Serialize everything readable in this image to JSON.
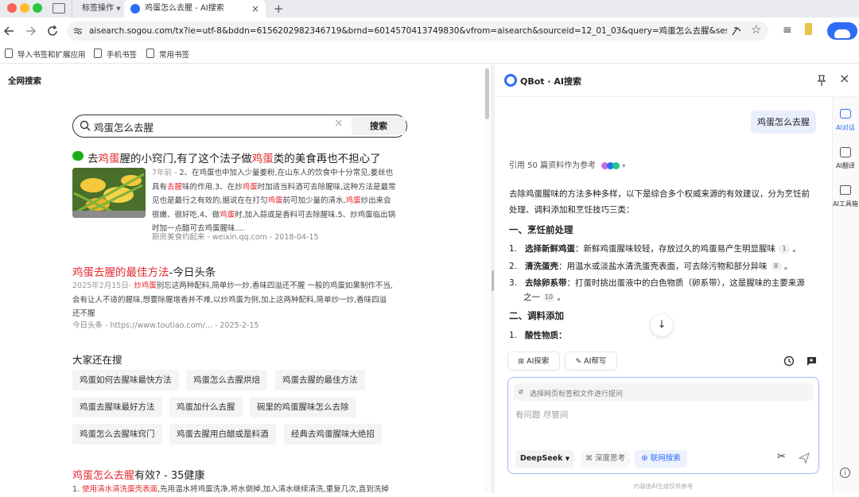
{
  "browser": {
    "tabs": [
      {
        "label": "标签操作"
      },
      {
        "label": "鸡蛋怎么去腥 - AI搜索"
      }
    ],
    "url": "aisearch.sogou.com/tx?ie=utf-8&bddn=6156202982346719&brnd=6014570413749830&vfrom=aisearch&sourceid=12_01_03&query=鸡蛋怎么去腥&session...",
    "bookmarks": [
      "导入书签和扩展应用",
      "手机书签",
      "常用书签"
    ]
  },
  "left": {
    "header": "全网搜索",
    "search_value": "鸡蛋怎么去腥",
    "search_button": "搜索",
    "r1": {
      "t": [
        "去",
        "鸡蛋",
        "腥的小窍门,有了这个法子做",
        "鸡蛋",
        "类的美食再也不担心了"
      ],
      "date": "7年前 - ",
      "l1b": "2、在鸡蛋也中加入少量姜粉,在山东人的饮食中十分常见,姜丝也",
      "l2a": "具有",
      "l2r": "去腥",
      "l2b": "味的作用.3、在炒",
      "l2r2": "鸡蛋",
      "l2c": "时加适当料酒可去除腥味,这种方法是最常",
      "l3a": "见也是最行之有效的,据说在在打匀",
      "l3r": "鸡蛋",
      "l3b": "前可加少量的清水,",
      "l3r2": "鸡蛋",
      "l3c": "炒出来会",
      "l4a": "很嫩、很好吃.4、做",
      "l4r": "鸡蛋",
      "l4b": "时,加入蒜或是香料可去除腥味.5、炒鸡蛋临出锅",
      "l5": "时加一点醋可去鸡蛋腥味....",
      "src": "厨房美食约起来 - weixin.qq.com  - 2018-04-15"
    },
    "r2": {
      "tr": "鸡蛋去腥的最佳方法",
      "tb": "-今日头条",
      "l1a": "2025年2月15日- ",
      "l1r": "炒鸡蛋",
      "l1b": "别忘这两种配料,简单炒一炒,香味四溢还不腥 一般的鸡蛋如果制作不当,",
      "l2": "会有让人不适的腥味,想要除腥增香并不难,以炒鸡蛋为例,加上这两种配料,简单炒一炒,香味四溢",
      "l3": "还不腥",
      "src": "今日头条  -  https://www.toutiao.com/...  - 2025-2-15"
    },
    "also": {
      "title": "大家还在搜",
      "items": [
        "鸡蛋如何去腥味最快方法",
        "鸡蛋怎么去腥烘焙",
        "鸡蛋去腥的最佳方法",
        "鸡蛋去腥味最好方法",
        "鸡蛋加什么去腥",
        "碗里的鸡蛋腥味怎么去除",
        "鸡蛋怎么去腥味窍门",
        "鸡蛋去腥用白醋或是料酒",
        "经典去鸡蛋腥味大绝招"
      ]
    },
    "r3": {
      "tr": "鸡蛋怎么去腥",
      "tb": "有效? - 35健康",
      "s1": "1. ",
      "s1r": "使用清水清洗蛋壳表面",
      "s1b": ",先用温水将鸡蛋洗净,将水倒掉,加入清水继续清洗,重复几次,直到洗掉"
    }
  },
  "right": {
    "brand": "QBot · AI搜索",
    "user_query": "鸡蛋怎么去腥",
    "ref": "引用 50 篇资料作为参考",
    "intro1": "去除鸡蛋腥味的方法多种多样，以下是综合多个权威来源的有效建议，分为烹饪前",
    "intro2": "处理、调料添加和烹饪技巧三类：",
    "h1": "一、烹饪前处理",
    "items": [
      {
        "n": "1.",
        "b": "选择新鲜鸡蛋",
        "t": "：新鲜鸡蛋腥味较轻，存放过久的鸡蛋易产生明显腥味",
        "c": "1"
      },
      {
        "n": "2.",
        "b": "清洗蛋壳",
        "t": "：用温水或淡盐水清洗蛋壳表面，可去除污物和部分异味",
        "c": "8"
      },
      {
        "n": "3.",
        "b": "去除卵系带",
        "t": "：打蛋时挑出蛋液中的白色物质（卵系带），这是腥味的主要来源",
        "t2": "之一",
        "c": "10"
      }
    ],
    "h2": "二、调料添加",
    "sub1n": "1.",
    "sub1": "酸性物质：",
    "btn_search": "AI探索",
    "btn_write": "AI帮写",
    "attach": "选择网页标签和文件进行提问",
    "placeholder": "有问题 尽管问",
    "model": "DeepSeek",
    "deep": "深度思考",
    "web": "联网搜索",
    "footer": "内容由AI生成仅供参考"
  },
  "rail": {
    "items": [
      "AI对话",
      "AI翻译",
      "AI工具箱"
    ]
  },
  "colors": {
    "accent": "#2f6cf6",
    "red": "#e4282f"
  }
}
